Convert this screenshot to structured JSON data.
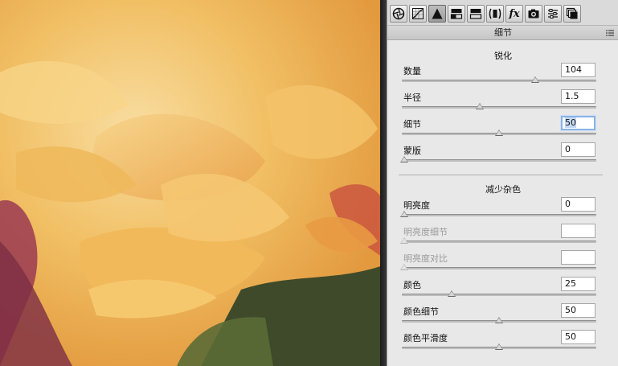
{
  "photo": {
    "icon": "flower-photo"
  },
  "toolbar": {
    "tabs": [
      {
        "icon": "aperture-icon",
        "active": false
      },
      {
        "icon": "tone-curve-icon",
        "active": false
      },
      {
        "icon": "detail-triangle-icon",
        "active": true
      },
      {
        "icon": "hsl-icon",
        "active": false
      },
      {
        "icon": "split-toning-icon",
        "active": false
      },
      {
        "icon": "lens-corrections-icon",
        "active": false
      },
      {
        "icon": "fx-icon",
        "active": false
      },
      {
        "icon": "camera-calibration-icon",
        "active": false
      },
      {
        "icon": "presets-icon",
        "active": false
      },
      {
        "icon": "snapshots-icon",
        "active": false
      }
    ],
    "fx_label": "fx"
  },
  "panel": {
    "title": "细节",
    "sharpening": {
      "title": "锐化",
      "amount": {
        "label": "数量",
        "value": "104",
        "level": 0.69
      },
      "radius": {
        "label": "半径",
        "value": "1.5",
        "level": 0.4
      },
      "detail": {
        "label": "细节",
        "value": "50",
        "level": 0.5
      },
      "masking": {
        "label": "蒙版",
        "value": "0",
        "level": 0.0
      }
    },
    "noise": {
      "title": "减少杂色",
      "luminance": {
        "label": "明亮度",
        "value": "0",
        "level": 0.0
      },
      "luminance_detail": {
        "label": "明亮度细节",
        "value": "",
        "level": 0.0
      },
      "luminance_contrast": {
        "label": "明亮度对比",
        "value": "",
        "level": 0.0
      },
      "color": {
        "label": "颜色",
        "value": "25",
        "level": 0.25
      },
      "color_detail": {
        "label": "颜色细节",
        "value": "50",
        "level": 0.5
      },
      "color_smoothness": {
        "label": "颜色平滑度",
        "value": "50",
        "level": 0.5
      }
    }
  }
}
